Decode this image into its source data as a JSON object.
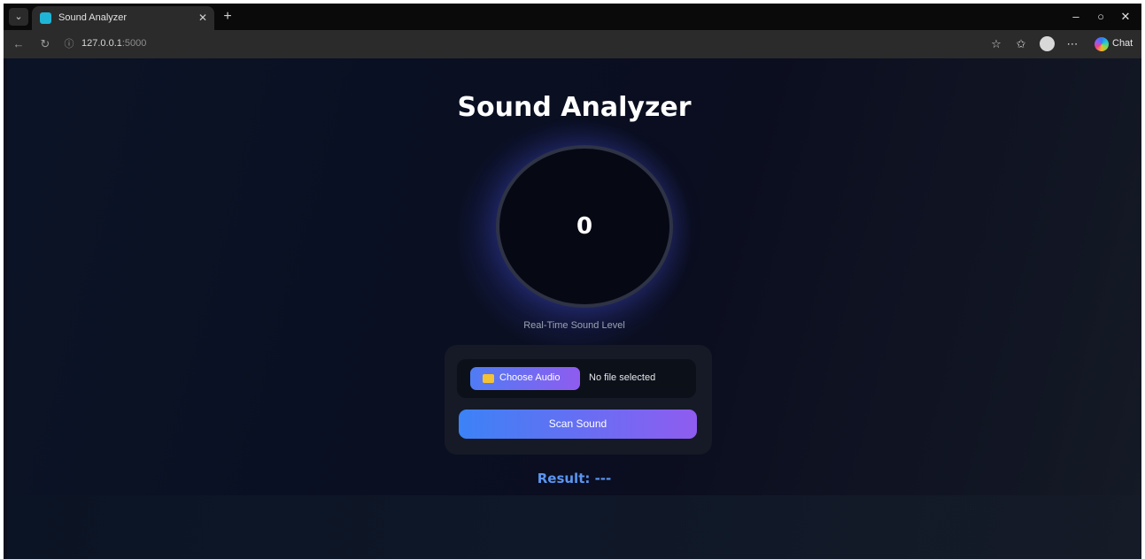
{
  "browser": {
    "tab": {
      "title": "Sound Analyzer"
    },
    "url": {
      "host": "127.0.0.1",
      "port": ":5000"
    },
    "chat_label": "Chat"
  },
  "page": {
    "title": "Sound Analyzer",
    "meter": {
      "value": "0",
      "caption": "Real-Time Sound Level"
    },
    "upload": {
      "choose_label": "Choose Audio",
      "file_status": "No file selected"
    },
    "scan_label": "Scan Sound",
    "result": "Result: ---"
  },
  "colors": {
    "accent_start": "#3c82f6",
    "accent_end": "#8f5cf0",
    "result_text": "#5b95f0",
    "background": "#0c0f1e"
  }
}
